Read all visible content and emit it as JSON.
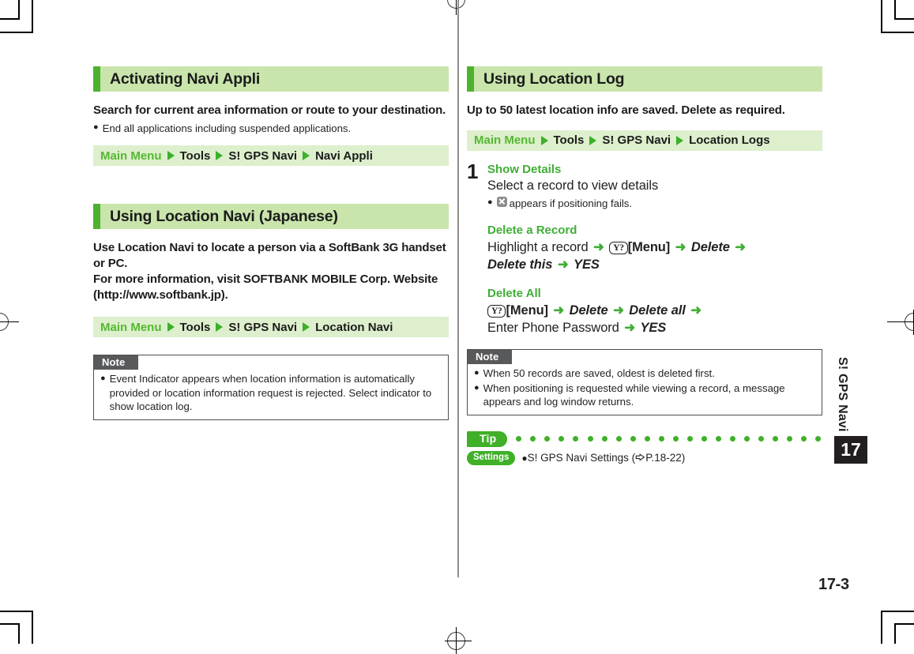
{
  "document": {
    "chapter_label": "S! GPS Navi",
    "chapter_number": "17",
    "folio": "17-3"
  },
  "left_column": {
    "sections": [
      {
        "heading": "Activating Navi Appli",
        "lead": "Search for current area information or route to your destination.",
        "bullets": [
          "End all applications including suspended applications."
        ],
        "breadcrumb": {
          "start": "Main Menu",
          "nodes": [
            "Tools",
            "S! GPS Navi",
            "Navi Appli"
          ]
        }
      },
      {
        "heading": "Using Location Navi (Japanese)",
        "lead_lines": [
          "Use Location Navi to locate a person via a SoftBank 3G handset or PC.",
          "For more information, visit SOFTBANK MOBILE Corp. Website (http://www.softbank.jp)."
        ],
        "breadcrumb": {
          "start": "Main Menu",
          "nodes": [
            "Tools",
            "S! GPS Navi",
            "Location Navi"
          ]
        }
      }
    ],
    "note": {
      "badge": "Note",
      "items": [
        "Event Indicator appears when location information is automatically provided or location information request is rejected. Select indicator to show location log."
      ]
    }
  },
  "right_column": {
    "section": {
      "heading": "Using Location Log",
      "lead": "Up to 50 latest location info are saved. Delete as required.",
      "breadcrumb": {
        "start": "Main Menu",
        "nodes": [
          "Tools",
          "S! GPS Navi",
          "Location Logs"
        ]
      }
    },
    "step": {
      "number": "1",
      "blocks": [
        {
          "subhead": "Show Details",
          "text": "Select a record to view details",
          "bullet_icon": "error-x-icon",
          "bullet": "appears if positioning fails."
        },
        {
          "subhead": "Delete a Record",
          "line1_pre": "Highlight a record",
          "key_glyph": "Y?",
          "key_label": "[Menu]",
          "line1_items": [
            "Delete"
          ],
          "line2_items": [
            "Delete this",
            "YES"
          ]
        },
        {
          "subhead": "Delete All",
          "key_glyph": "Y?",
          "key_label": "[Menu]",
          "line1_items": [
            "Delete",
            "Delete all"
          ],
          "line2_pre": "Enter Phone Password",
          "line2_items": [
            "YES"
          ]
        }
      ]
    },
    "note": {
      "badge": "Note",
      "items": [
        "When 50 records are saved, oldest is deleted first.",
        "When positioning is requested while viewing a record, a message appears and log window returns."
      ]
    },
    "tip": {
      "badge": "Tip",
      "dot_count": 22,
      "settings_badge": "Settings",
      "text_before": "S! GPS Navi  Settings (",
      "ref": "P.18-22",
      "text_after": ")"
    }
  },
  "colors": {
    "accent_green": "#3fb028",
    "head_band": "#c9e5ac",
    "head_tick": "#4cb22e",
    "breadcrumb_band": "#ddefcc",
    "note_gray": "#58595b",
    "ink": "#231f20"
  }
}
